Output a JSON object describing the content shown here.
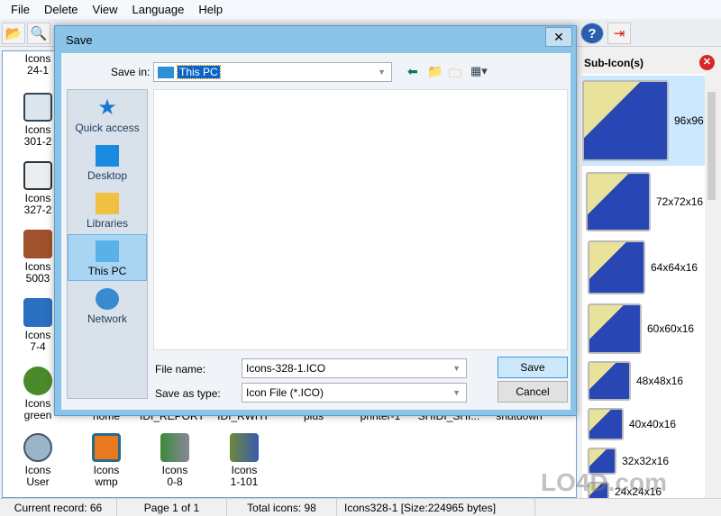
{
  "menu": [
    "File",
    "Delete",
    "View",
    "Language",
    "Help"
  ],
  "icons_left": [
    {
      "line1": "Icons",
      "line2": "24-1"
    },
    {
      "line1": "Icons",
      "line2": "301-2"
    },
    {
      "line1": "Icons",
      "line2": "327-2"
    },
    {
      "line1": "Icons",
      "line2": "5003"
    },
    {
      "line1": "Icons",
      "line2": "7-4"
    },
    {
      "line1": "Icons",
      "line2": "green"
    }
  ],
  "icons_partial": [
    "home",
    "IDI_REPORT",
    "IDI_RWHT",
    "plus",
    "printer-1",
    "SHIDI_SHI...",
    "shutdown"
  ],
  "icons_bottom": [
    {
      "line1": "Icons",
      "line2": "User"
    },
    {
      "line1": "Icons",
      "line2": "wmp"
    },
    {
      "line1": "Icons",
      "line2": "0-8"
    },
    {
      "line1": "Icons",
      "line2": "1-101"
    }
  ],
  "sub_panel": {
    "title": "Sub-Icon(s)",
    "items": [
      "96x96",
      "72x72x16",
      "64x64x16",
      "60x60x16",
      "48x48x16",
      "40x40x16",
      "32x32x16",
      "24x24x16"
    ]
  },
  "status": {
    "record": "Current record: 66",
    "page": "Page 1 of 1",
    "total": "Total icons: 98",
    "file": "Icons328-1 [Size:224965 bytes]"
  },
  "dialog": {
    "title": "Save",
    "save_in_label": "Save in:",
    "save_in_value": "This PC",
    "places": [
      "Quick access",
      "Desktop",
      "Libraries",
      "This PC",
      "Network"
    ],
    "file_name_label": "File name:",
    "file_name_value": "Icons-328-1.ICO",
    "type_label": "Save as type:",
    "type_value": "Icon File (*.ICO)",
    "save_button": "Save",
    "cancel_button": "Cancel"
  },
  "watermark": "LO4D.com"
}
